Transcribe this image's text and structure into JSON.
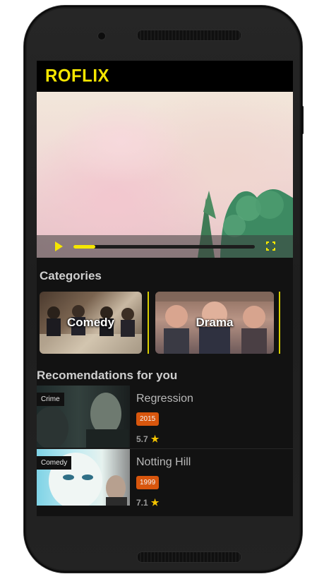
{
  "app": {
    "logo": "ROFLIX"
  },
  "player": {
    "progress": 0.12,
    "play_icon": "play-icon",
    "fullscreen_icon": "fullscreen-icon"
  },
  "categories": {
    "title": "Categories",
    "items": [
      {
        "label": "Comedy"
      },
      {
        "label": "Drama"
      }
    ]
  },
  "recommendations": {
    "title": "Recomendations for you",
    "items": [
      {
        "genre": "Crime",
        "title": "Regression",
        "year": "2015",
        "rating": "5.7"
      },
      {
        "genre": "Comedy",
        "title": "Notting Hill",
        "year": "1999",
        "rating": "7.1"
      }
    ]
  },
  "colors": {
    "accent": "#f5e600",
    "year_badge": "#d8560d",
    "background": "#121212"
  }
}
